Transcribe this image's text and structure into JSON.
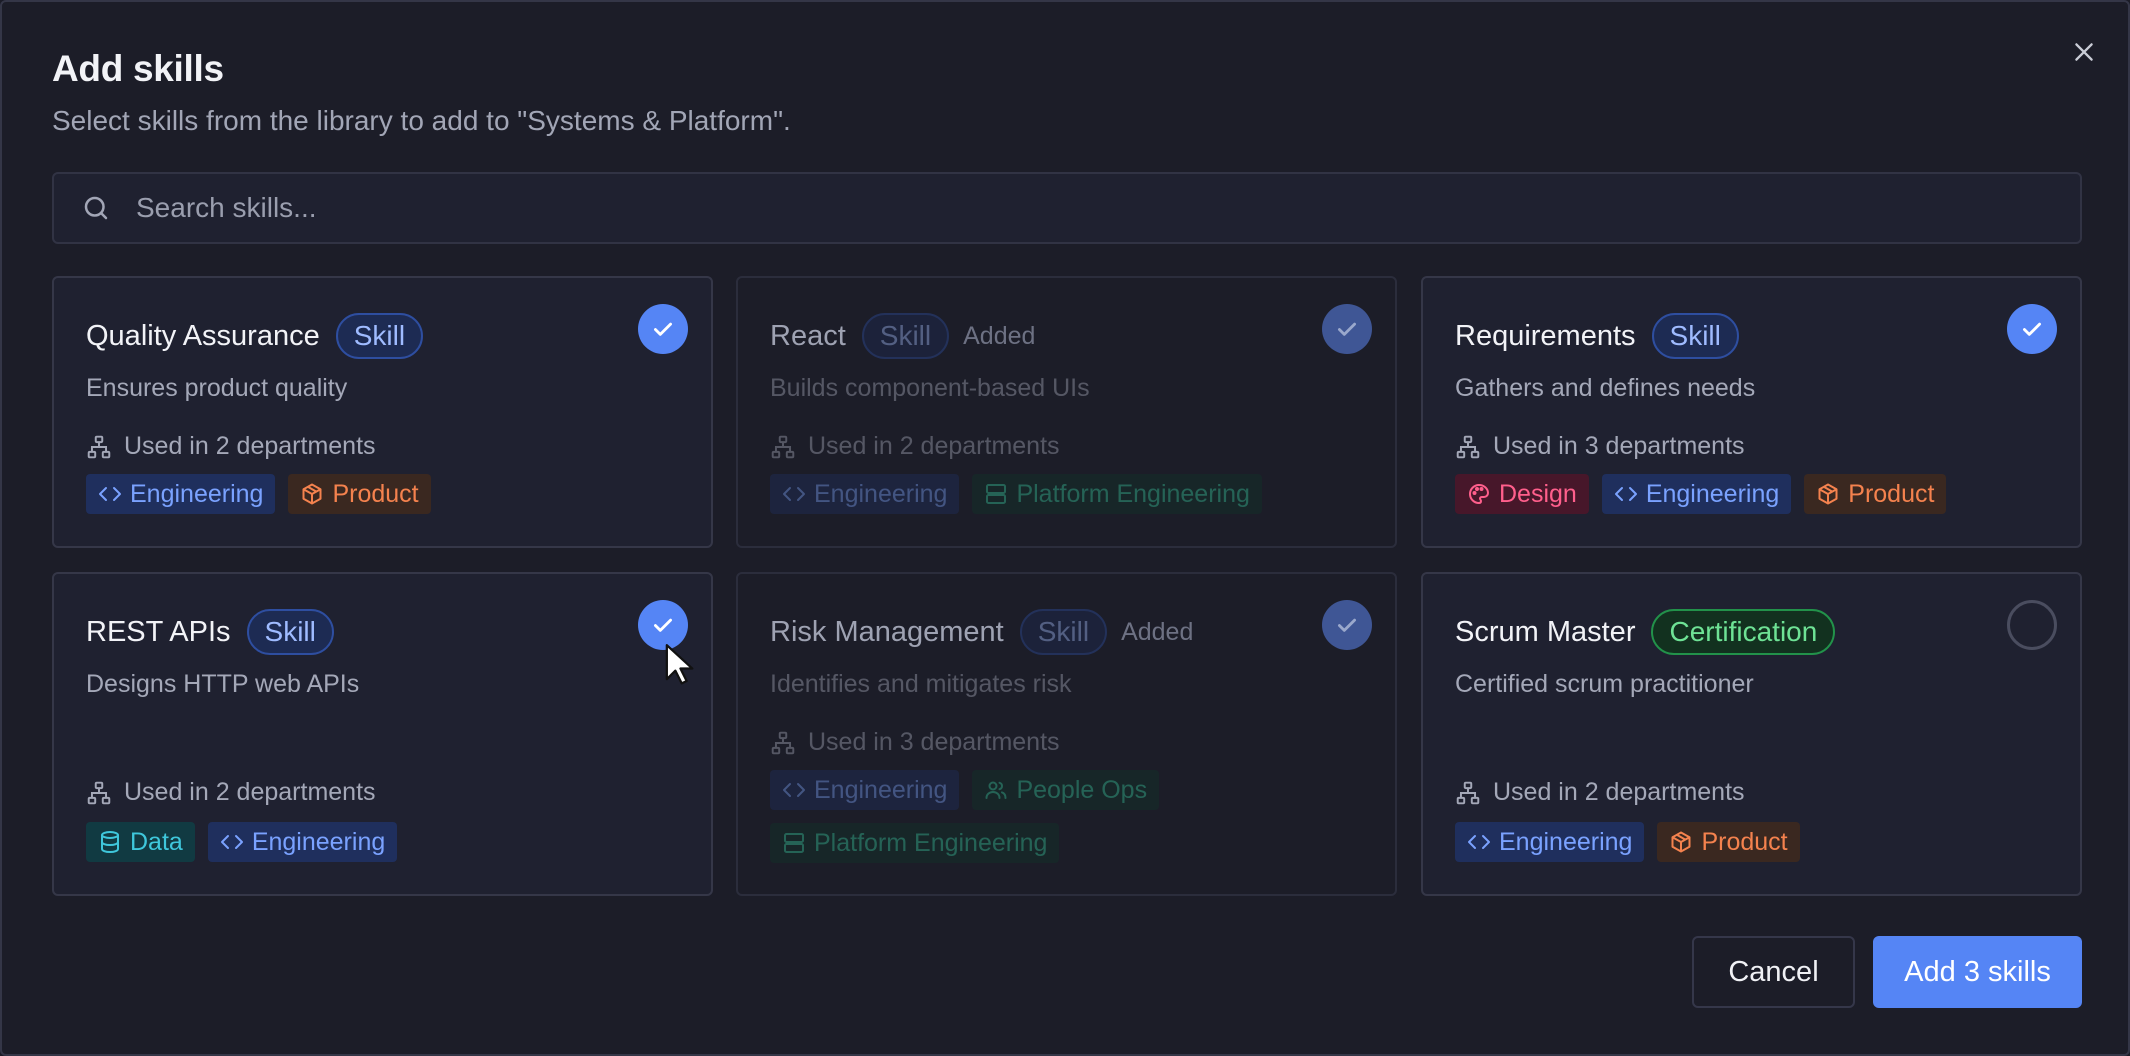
{
  "dialog": {
    "title": "Add skills",
    "subtitle": "Select skills from the library to add to \"Systems & Platform\"."
  },
  "search": {
    "placeholder": "Search skills...",
    "value": ""
  },
  "cards": [
    {
      "name": "Quality Assurance",
      "badge": "Skill",
      "added_label": "",
      "state": "selected",
      "description": "Ensures product quality",
      "usage": "Used in 2 departments",
      "tags": [
        {
          "label": "Engineering",
          "icon": "code-icon"
        },
        {
          "label": "Product",
          "icon": "box-icon"
        }
      ]
    },
    {
      "name": "React",
      "badge": "Skill",
      "added_label": "Added",
      "state": "added",
      "description": "Builds component-based UIs",
      "usage": "Used in 2 departments",
      "tags": [
        {
          "label": "Engineering",
          "icon": "code-icon"
        },
        {
          "label": "Platform Engineering",
          "icon": "server-icon"
        }
      ]
    },
    {
      "name": "Requirements",
      "badge": "Skill",
      "added_label": "",
      "state": "selected",
      "description": "Gathers and defines needs",
      "usage": "Used in 3 departments",
      "tags": [
        {
          "label": "Design",
          "icon": "palette-icon"
        },
        {
          "label": "Engineering",
          "icon": "code-icon"
        },
        {
          "label": "Product",
          "icon": "box-icon"
        }
      ]
    },
    {
      "name": "REST APIs",
      "badge": "Skill",
      "added_label": "",
      "state": "selected",
      "description": "Designs HTTP web APIs",
      "usage": "Used in 2 departments",
      "tags": [
        {
          "label": "Data",
          "icon": "database-icon"
        },
        {
          "label": "Engineering",
          "icon": "code-icon"
        }
      ]
    },
    {
      "name": "Risk Management",
      "badge": "Skill",
      "added_label": "Added",
      "state": "added",
      "description": "Identifies and mitigates risk",
      "usage": "Used in 3 departments",
      "tags": [
        {
          "label": "Engineering",
          "icon": "code-icon"
        },
        {
          "label": "People Ops",
          "icon": "users-icon"
        },
        {
          "label": "Platform Engineering",
          "icon": "server-icon"
        }
      ]
    },
    {
      "name": "Scrum Master",
      "badge": "Certification",
      "added_label": "",
      "state": "unselected",
      "description": "Certified scrum practitioner",
      "usage": "Used in 2 departments",
      "tags": [
        {
          "label": "Engineering",
          "icon": "code-icon"
        },
        {
          "label": "Product",
          "icon": "box-icon"
        }
      ]
    }
  ],
  "footer": {
    "cancel_label": "Cancel",
    "submit_label": "Add 3 skills"
  },
  "colors": {
    "accent": "#5585f5",
    "background": "#1c1d28",
    "card": "#1f2130",
    "certification": "#22924a"
  }
}
